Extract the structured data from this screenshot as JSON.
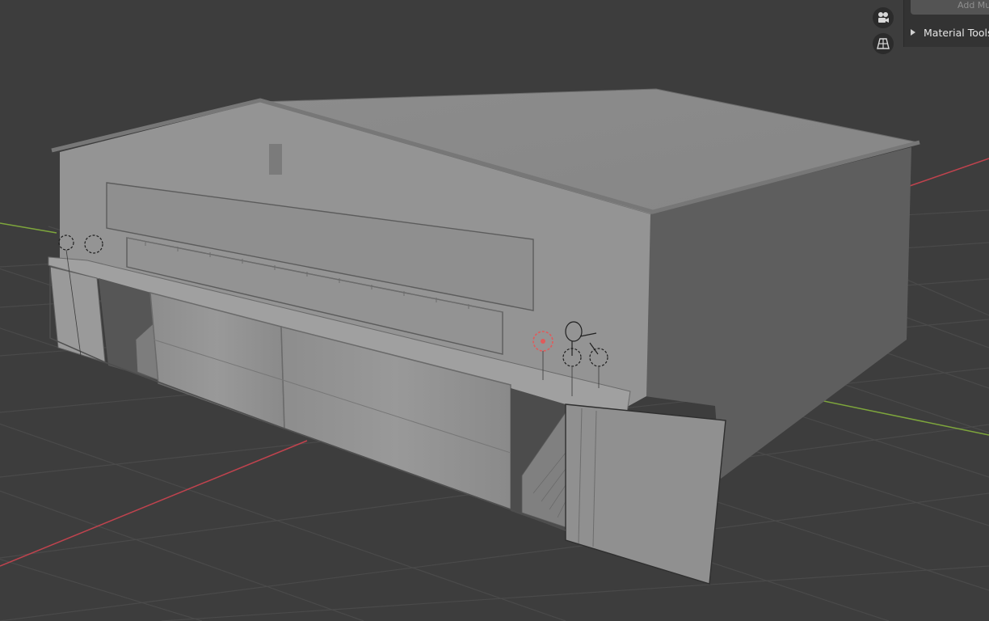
{
  "viewport": {
    "background": "#3d3d3d",
    "grid_color": "#4a4a4a",
    "x_axis_color": "#c0434e",
    "y_axis_color": "#7ea63c"
  },
  "navigation_gizmo": {
    "icons": [
      "camera-icon",
      "perspective-grid-icon"
    ]
  },
  "sidebar": {
    "add_button_label": "Add Multi",
    "material_tools_label": "Material Tools"
  }
}
